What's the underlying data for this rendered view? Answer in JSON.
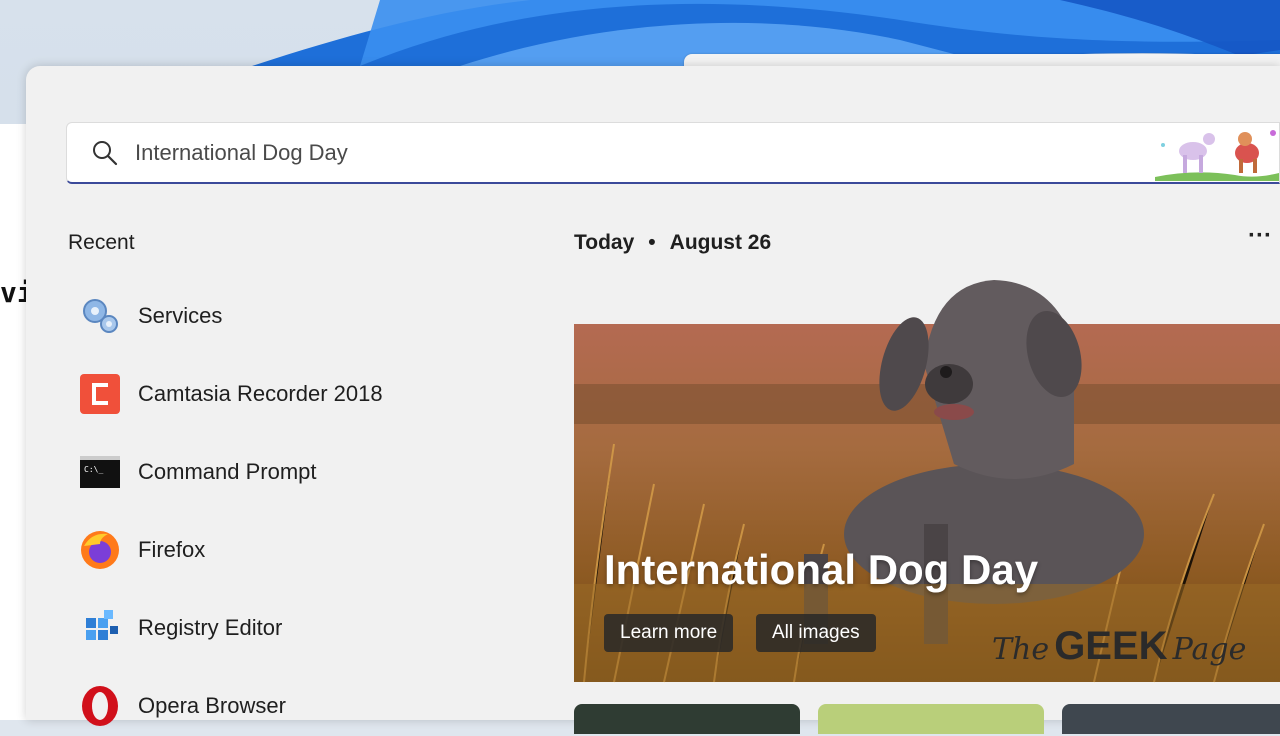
{
  "search": {
    "value": "International Dog Day",
    "placeholder": ""
  },
  "recent": {
    "title": "Recent",
    "items": [
      {
        "label": "Services",
        "icon": "services-gear-icon"
      },
      {
        "label": "Camtasia Recorder 2018",
        "icon": "camtasia-icon"
      },
      {
        "label": "Command Prompt",
        "icon": "command-prompt-icon"
      },
      {
        "label": "Firefox",
        "icon": "firefox-icon"
      },
      {
        "label": "Registry Editor",
        "icon": "registry-editor-icon"
      },
      {
        "label": "Opera Browser",
        "icon": "opera-icon"
      }
    ]
  },
  "today": {
    "label": "Today",
    "date": "August 26",
    "more": "···"
  },
  "hero": {
    "title": "International Dog Day",
    "learn_more": "Learn more",
    "all_images": "All images",
    "watermark": {
      "the": "The",
      "geek": "GEEK",
      "page": "Page"
    }
  },
  "background_window": {
    "text": "vi"
  },
  "colors": {
    "accent": "#3b4a9a",
    "panel": "#f1f1f1",
    "camtasia": "#f0503a",
    "opera": "#d1101b"
  }
}
